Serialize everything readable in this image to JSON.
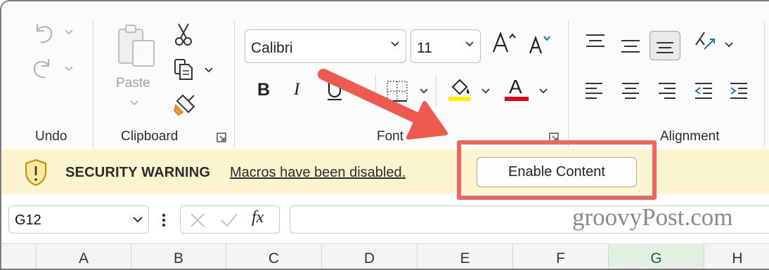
{
  "ribbon": {
    "undo_group": {
      "label": "Undo"
    },
    "clipboard_group": {
      "label": "Clipboard",
      "paste_label": "Paste"
    },
    "font_group": {
      "label": "Font",
      "font_name": "Calibri",
      "font_size": "11",
      "bold": "B",
      "italic": "I",
      "font_color_letter": "A"
    },
    "alignment_group": {
      "label": "Alignment"
    }
  },
  "security_bar": {
    "title": "SECURITY WARNING",
    "message": "Macros have been disabled.",
    "enable_button": "Enable Content"
  },
  "formula_bar": {
    "name_box": "G12",
    "fx": "fx",
    "value": ""
  },
  "watermark": "groovyPost.com",
  "columns": [
    "A",
    "B",
    "C",
    "D",
    "E",
    "F",
    "G",
    "H"
  ],
  "selected_column": "G",
  "colors": {
    "highlight_box": "#ef6559",
    "arrow": "#ef5a4f",
    "security_bar_bg": "#fbf5cf",
    "fill_color_bar": "#ffee00",
    "font_color_bar": "#e0001a",
    "selected_column": "#107c41"
  },
  "icons": [
    "undo-icon",
    "redo-icon",
    "paste-icon",
    "cut-icon",
    "copy-icon",
    "format-painter-icon",
    "increase-font-icon",
    "decrease-font-icon",
    "underline-icon",
    "borders-icon",
    "fill-color-icon",
    "font-color-icon",
    "align-top-icon",
    "align-middle-icon",
    "align-bottom-icon",
    "orientation-icon",
    "align-left-icon",
    "align-center-icon",
    "align-right-icon",
    "decrease-indent-icon",
    "increase-indent-icon",
    "dialog-launcher-icon",
    "shield-warning-icon",
    "cancel-icon",
    "enter-icon"
  ]
}
